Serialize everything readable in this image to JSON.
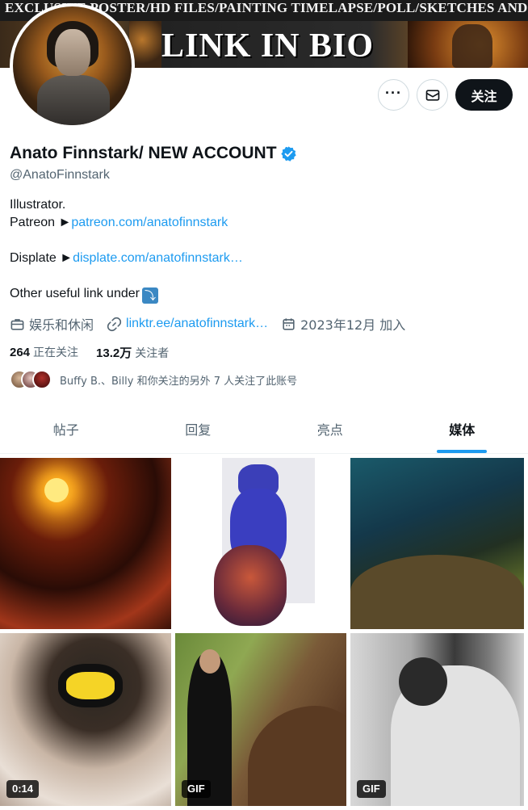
{
  "banner": {
    "top_text": "EXCLUSIVE POSTER/HD FILES/PAINTING TIMELAPSE/POLL/SKETCHES AND MORE",
    "main_text": "LINK IN BIO"
  },
  "actions": {
    "more_label": "···",
    "follow_label": "关注"
  },
  "profile": {
    "name": "Anato Finnstark/ NEW ACCOUNT",
    "handle": "@AnatoFinnstark",
    "bio": {
      "line1": "Illustrator.",
      "patreon_prefix": "Patreon ►",
      "patreon_link": "patreon.com/anatofinnstark",
      "displate_prefix": "Displate ►",
      "displate_link": "displate.com/anatofinnstark…",
      "other_text": "Other useful link under",
      "other_emoji": "⤵"
    },
    "category": "娱乐和休闲",
    "website": "linktr.ee/anatofinnstark…",
    "joined": "2023年12月 加入",
    "following_count": "264",
    "following_label": "正在关注",
    "followers_count": "13.2万",
    "followers_label": "关注者",
    "known_followers_text": "Buffy B.、Billy 和你关注的另外 7 人关注了此账号"
  },
  "tabs": [
    {
      "label": "帖子"
    },
    {
      "label": "回复"
    },
    {
      "label": "亮点"
    },
    {
      "label": "媒体"
    }
  ],
  "active_tab": "媒体",
  "media": [
    {
      "badge": ""
    },
    {
      "badge": ""
    },
    {
      "badge": ""
    },
    {
      "badge": "0:14"
    },
    {
      "badge": "GIF"
    },
    {
      "badge": "GIF"
    }
  ],
  "colors": {
    "accent": "#1d9bf0",
    "text_primary": "#0f1419",
    "text_secondary": "#536471",
    "follow_button": "#0f1419"
  },
  "icons": {
    "more": "more-dots-icon",
    "mail": "mail-icon",
    "verified": "verified-badge-icon",
    "category": "briefcase-icon",
    "website": "link-icon",
    "joined": "calendar-icon"
  }
}
